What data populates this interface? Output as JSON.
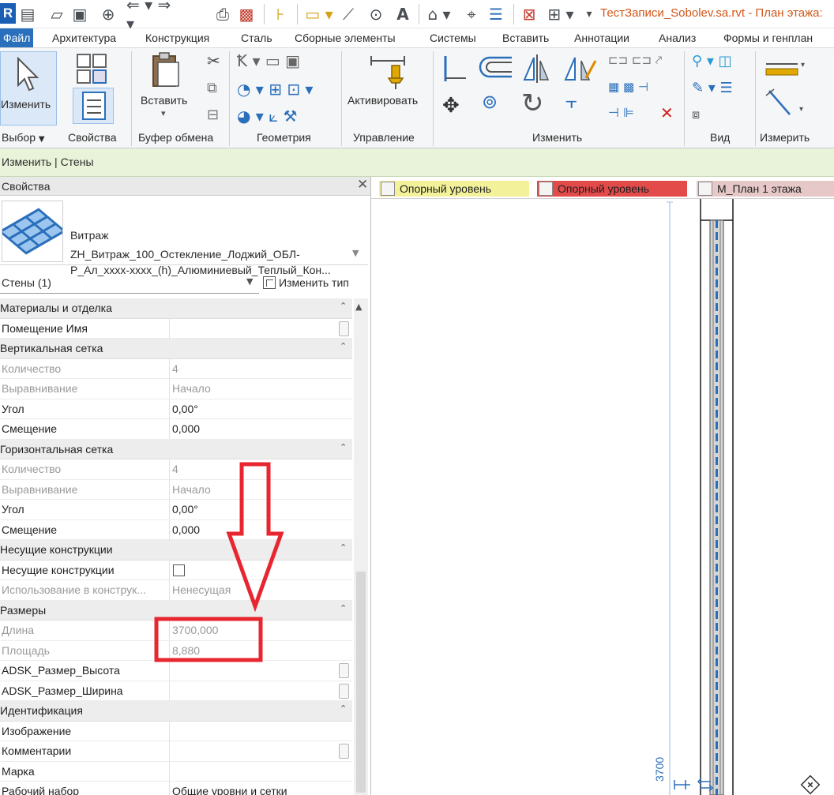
{
  "qat": {
    "app_letter": "R",
    "title": "ТестЗаписи_Sobolev.sa.rvt - План этажа:"
  },
  "tabs": [
    "Файл",
    "Архитектура",
    "Конструкция",
    "Сталь",
    "Сборные элементы",
    "Системы",
    "Вставить",
    "Аннотации",
    "Анализ",
    "Формы и генплан"
  ],
  "ribbon": {
    "modify_label": "Изменить",
    "paste_label": "Вставить",
    "activate_label": "Активировать",
    "panels": {
      "select": "Выбор",
      "properties": "Свойства",
      "clipboard": "Буфер обмена",
      "geometry": "Геометрия",
      "control": "Управление",
      "modify": "Изменить",
      "view": "Вид",
      "measure": "Измерить"
    }
  },
  "context": "Изменить | Стены",
  "properties": {
    "header": "Свойства",
    "close": "✕",
    "type_family": "Витраж",
    "type_name_1": "ZH_Витраж_100_Остекление_Лоджий_ОБЛ-",
    "type_name_2": "Р_Ал_xxxx-xxxx_(h)_Алюминиевый_Теплый_Кон...",
    "selector": "Стены (1)",
    "edit_type": "Изменить тип",
    "rows": [
      {
        "kind": "group",
        "k": "Материалы и отделка"
      },
      {
        "kind": "row",
        "k": "Помещение Имя",
        "v": "",
        "btn": true
      },
      {
        "kind": "group",
        "k": "Вертикальная сетка"
      },
      {
        "kind": "dim",
        "k": "Количество",
        "v": "4"
      },
      {
        "kind": "dim",
        "k": "Выравнивание",
        "v": "Начало"
      },
      {
        "kind": "row",
        "k": "Угол",
        "v": "0,00°"
      },
      {
        "kind": "row",
        "k": "Смещение",
        "v": "0,000"
      },
      {
        "kind": "group",
        "k": "Горизонтальная сетка"
      },
      {
        "kind": "dim",
        "k": "Количество",
        "v": "4"
      },
      {
        "kind": "dim",
        "k": "Выравнивание",
        "v": "Начало"
      },
      {
        "kind": "row",
        "k": "Угол",
        "v": "0,00°"
      },
      {
        "kind": "row",
        "k": "Смещение",
        "v": "0,000"
      },
      {
        "kind": "group",
        "k": "Несущие конструкции"
      },
      {
        "kind": "row",
        "k": "Несущие конструкции",
        "v": "",
        "check": true
      },
      {
        "kind": "dim",
        "k": "Использование в конструк...",
        "v": "Ненесущая"
      },
      {
        "kind": "group",
        "k": "Размеры"
      },
      {
        "kind": "dim",
        "k": "Длина",
        "v": "3700,000"
      },
      {
        "kind": "dim",
        "k": "Площадь",
        "v": "8,880"
      },
      {
        "kind": "row",
        "k": "ADSK_Размер_Высота",
        "v": "",
        "btn": true
      },
      {
        "kind": "row",
        "k": "ADSK_Размер_Ширина",
        "v": "",
        "btn": true
      },
      {
        "kind": "group",
        "k": "Идентификация"
      },
      {
        "kind": "row",
        "k": "Изображение",
        "v": ""
      },
      {
        "kind": "row",
        "k": "Комментарии",
        "v": "",
        "btn": true
      },
      {
        "kind": "row",
        "k": "Марка",
        "v": ""
      },
      {
        "kind": "row",
        "k": "Рабочий набор",
        "v": "Общие уровни и сетки"
      }
    ]
  },
  "view": {
    "tabs": [
      {
        "label": "Опорный уровень",
        "color": "yellow"
      },
      {
        "label": "Опорный уровень",
        "color": "red"
      },
      {
        "label": "М_План 1 этажа",
        "color": "pink"
      }
    ],
    "dimension_text": "3700"
  },
  "colors": {
    "accent": "#2a6fbb",
    "context_bar": "#e9f3d9",
    "annotation_red": "#e8262f",
    "title_orange": "#d2561a"
  }
}
